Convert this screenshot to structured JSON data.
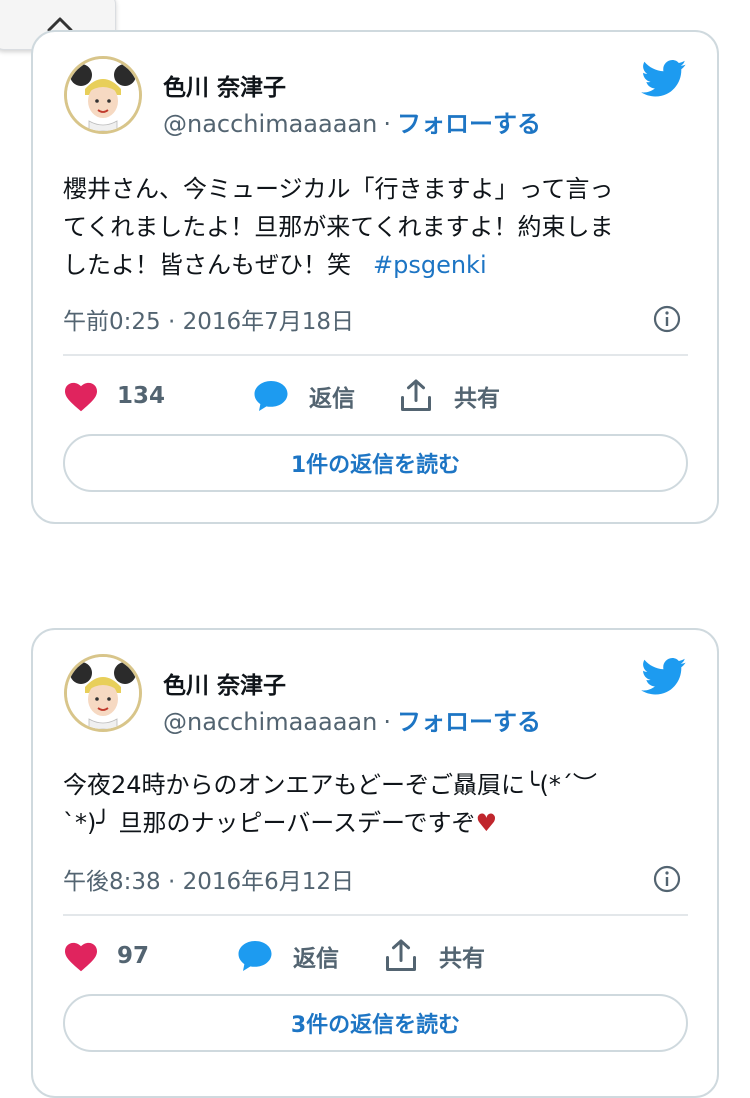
{
  "collapse_icon": "chevron-up-icon",
  "colors": {
    "link": "#1d75c4",
    "like": "#e0245e",
    "border": "#cfd9de",
    "text": "#0f1419",
    "muted": "#536471"
  },
  "tweets": [
    {
      "author_name": "色川 奈津子",
      "handle": "@nacchimaaaaan",
      "separator": "·",
      "follow_label": "フォローする",
      "text_lines": [
        "櫻井さん、今ミュージカル「行きますよ」って言っ",
        "てくれましたよ！旦那が来てくれますよ！約束しま",
        "したよ！皆さんもぜひ！笑"
      ],
      "hashtag": "#psgenki",
      "timestamp": "午前0:25 · 2016年7月18日",
      "like_count": "134",
      "reply_label": "返信",
      "share_label": "共有",
      "read_replies_label": "1件の返信を読む"
    },
    {
      "author_name": "色川 奈津子",
      "handle": "@nacchimaaaaan",
      "separator": "·",
      "follow_label": "フォローする",
      "text_lines": [
        "今夜24時からのオンエアもどーぞご贔屓に╰(*´︶",
        "`*)╯ 旦那のナッピーバースデーですぞ"
      ],
      "heart_emoji": "♥",
      "timestamp": "午後8:38 · 2016年6月12日",
      "like_count": "97",
      "reply_label": "返信",
      "share_label": "共有",
      "read_replies_label": "3件の返信を読む"
    }
  ]
}
